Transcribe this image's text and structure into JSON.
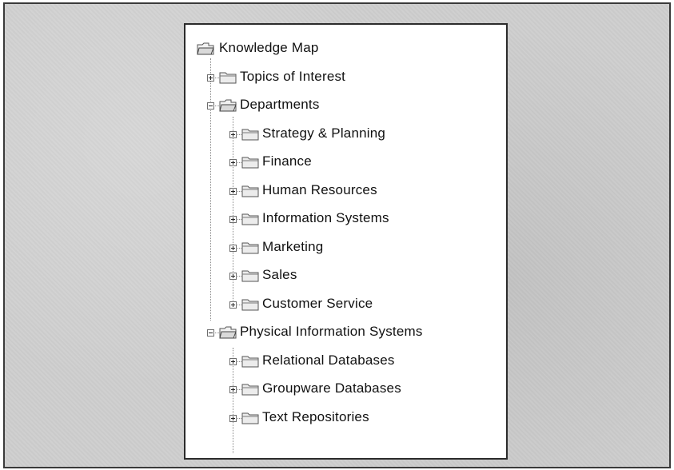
{
  "tree": {
    "root": {
      "label": "Knowledge Map",
      "icon": "open-folder-icon"
    },
    "items": [
      {
        "label": "Topics of Interest",
        "expander": "plus",
        "icon": "folder-icon"
      },
      {
        "label": "Departments",
        "expander": "minus",
        "icon": "open-folder-icon",
        "children": [
          {
            "label": "Strategy & Planning",
            "expander": "plus",
            "icon": "folder-icon"
          },
          {
            "label": "Finance",
            "expander": "plus",
            "icon": "folder-icon"
          },
          {
            "label": "Human Resources",
            "expander": "plus",
            "icon": "folder-icon"
          },
          {
            "label": "Information Systems",
            "expander": "plus",
            "icon": "folder-icon"
          },
          {
            "label": "Marketing",
            "expander": "plus",
            "icon": "folder-icon"
          },
          {
            "label": "Sales",
            "expander": "plus",
            "icon": "folder-icon"
          },
          {
            "label": "Customer Service",
            "expander": "plus",
            "icon": "folder-icon"
          }
        ]
      },
      {
        "label": "Physical Information Systems",
        "expander": "minus",
        "icon": "open-folder-icon",
        "children": [
          {
            "label": "Relational Databases",
            "expander": "plus",
            "icon": "folder-icon"
          },
          {
            "label": "Groupware Databases",
            "expander": "plus",
            "icon": "folder-icon"
          },
          {
            "label": "Text Repositories",
            "expander": "plus",
            "icon": "folder-icon"
          }
        ]
      }
    ]
  }
}
